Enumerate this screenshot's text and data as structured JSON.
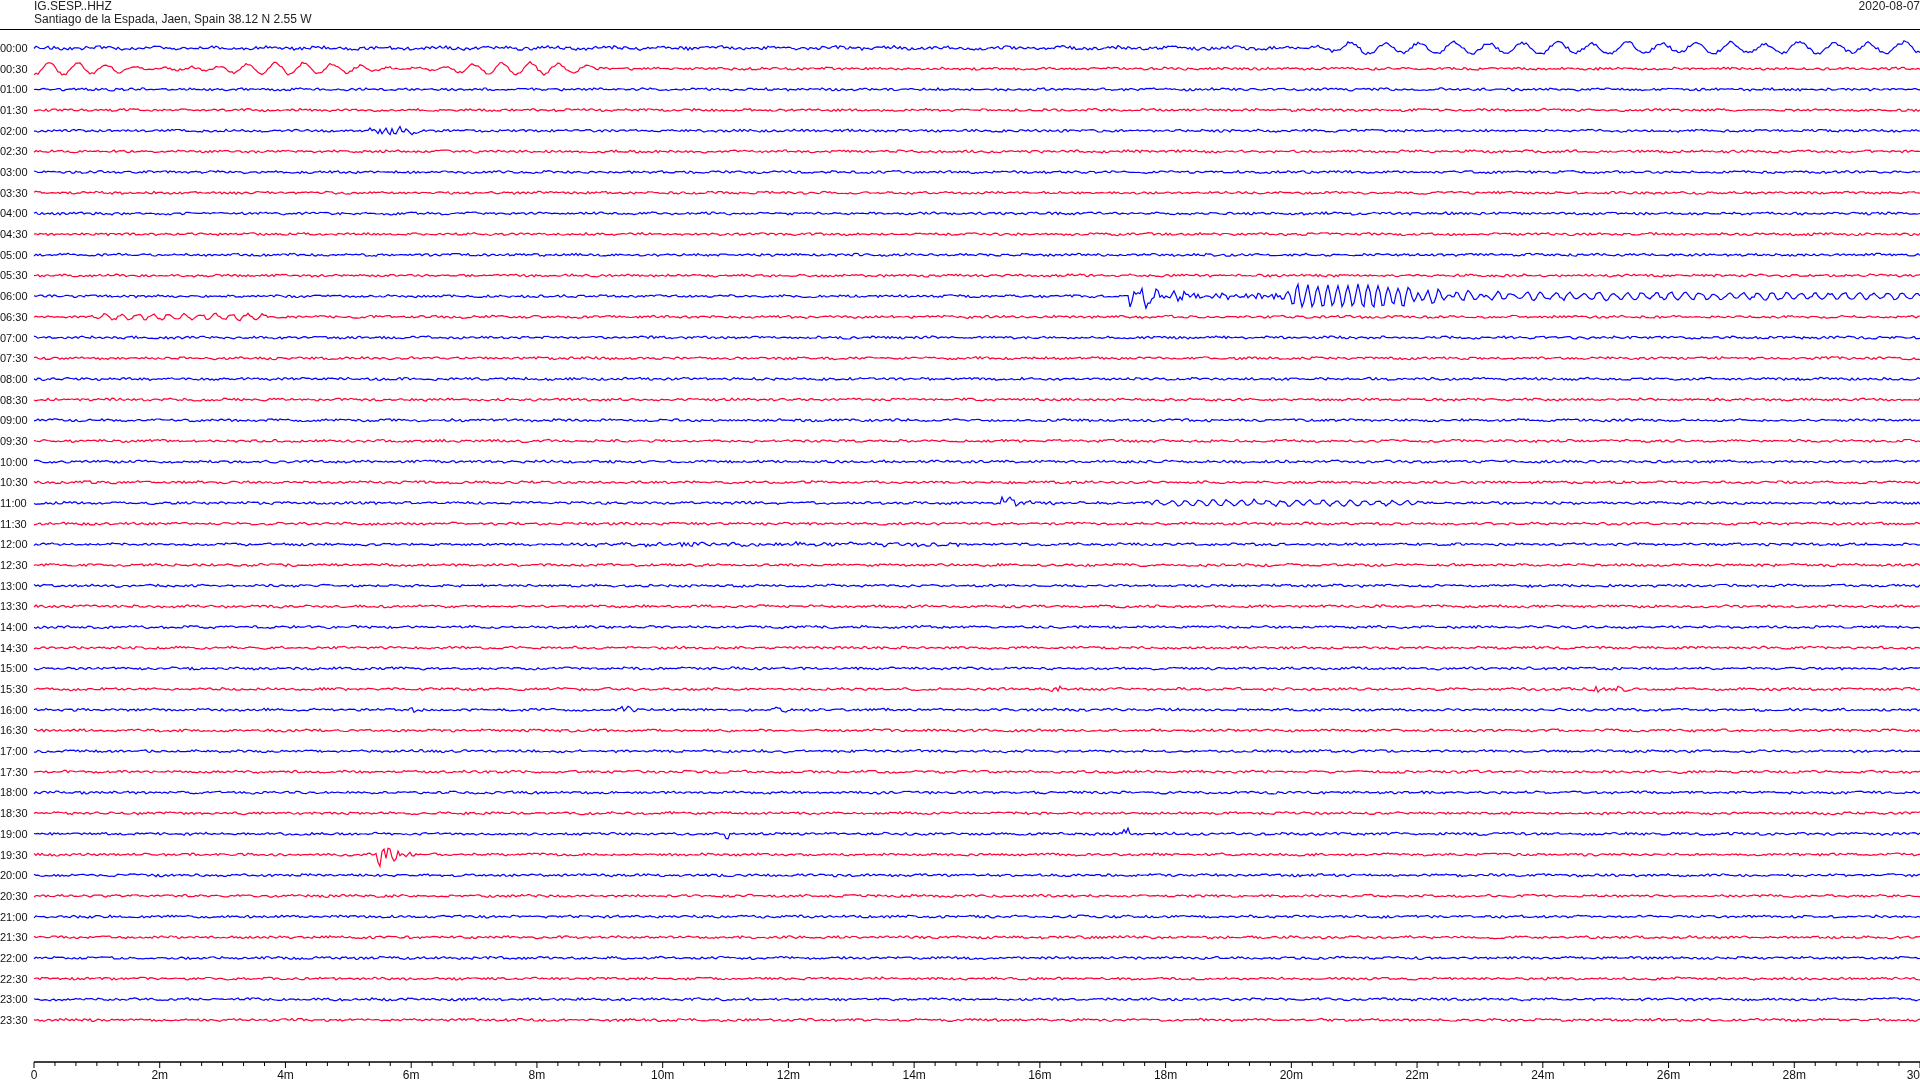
{
  "header": {
    "channel": "IG.SESP..HHZ",
    "station": "Santiago de la Espada, Jaen, Spain  38.12 N 2.55 W",
    "date": "2020-08-07"
  },
  "rows": [
    {
      "label": "00:00",
      "color": "#0000ff"
    },
    {
      "label": "00:30",
      "color": "#ff0033"
    },
    {
      "label": "01:00",
      "color": "#0000ff"
    },
    {
      "label": "01:30",
      "color": "#ff0033"
    },
    {
      "label": "02:00",
      "color": "#0000ff"
    },
    {
      "label": "02:30",
      "color": "#ff0033"
    },
    {
      "label": "03:00",
      "color": "#0000ff"
    },
    {
      "label": "03:30",
      "color": "#ff0033"
    },
    {
      "label": "04:00",
      "color": "#0000ff"
    },
    {
      "label": "04:30",
      "color": "#ff0033"
    },
    {
      "label": "05:00",
      "color": "#0000ff"
    },
    {
      "label": "05:30",
      "color": "#ff0033"
    },
    {
      "label": "06:00",
      "color": "#0000ff"
    },
    {
      "label": "06:30",
      "color": "#ff0033"
    },
    {
      "label": "07:00",
      "color": "#0000ff"
    },
    {
      "label": "07:30",
      "color": "#ff0033"
    },
    {
      "label": "08:00",
      "color": "#0000ff"
    },
    {
      "label": "08:30",
      "color": "#ff0033"
    },
    {
      "label": "09:00",
      "color": "#0000ff"
    },
    {
      "label": "09:30",
      "color": "#ff0033"
    },
    {
      "label": "10:00",
      "color": "#0000ff"
    },
    {
      "label": "10:30",
      "color": "#ff0033"
    },
    {
      "label": "11:00",
      "color": "#0000ff"
    },
    {
      "label": "11:30",
      "color": "#ff0033"
    },
    {
      "label": "12:00",
      "color": "#0000ff"
    },
    {
      "label": "12:30",
      "color": "#ff0033"
    },
    {
      "label": "13:00",
      "color": "#0000ff"
    },
    {
      "label": "13:30",
      "color": "#ff0033"
    },
    {
      "label": "14:00",
      "color": "#0000ff"
    },
    {
      "label": "14:30",
      "color": "#ff0033"
    },
    {
      "label": "15:00",
      "color": "#0000ff"
    },
    {
      "label": "15:30",
      "color": "#ff0033"
    },
    {
      "label": "16:00",
      "color": "#0000ff"
    },
    {
      "label": "16:30",
      "color": "#ff0033"
    },
    {
      "label": "17:00",
      "color": "#0000ff"
    },
    {
      "label": "17:30",
      "color": "#ff0033"
    },
    {
      "label": "18:00",
      "color": "#0000ff"
    },
    {
      "label": "18:30",
      "color": "#ff0033"
    },
    {
      "label": "19:00",
      "color": "#0000ff"
    },
    {
      "label": "19:30",
      "color": "#ff0033"
    },
    {
      "label": "20:00",
      "color": "#0000ff"
    },
    {
      "label": "20:30",
      "color": "#ff0033"
    },
    {
      "label": "21:00",
      "color": "#0000ff"
    },
    {
      "label": "21:30",
      "color": "#ff0033"
    },
    {
      "label": "22:00",
      "color": "#0000ff"
    },
    {
      "label": "22:30",
      "color": "#ff0033"
    },
    {
      "label": "23:00",
      "color": "#0000ff"
    },
    {
      "label": "23:30",
      "color": "#ff0033"
    }
  ],
  "x_axis": {
    "ticks": [
      "0",
      "2m",
      "4m",
      "6m",
      "8m",
      "10m",
      "12m",
      "14m",
      "16m",
      "18m",
      "20m",
      "22m",
      "24m",
      "26m",
      "28m",
      "30"
    ]
  }
}
